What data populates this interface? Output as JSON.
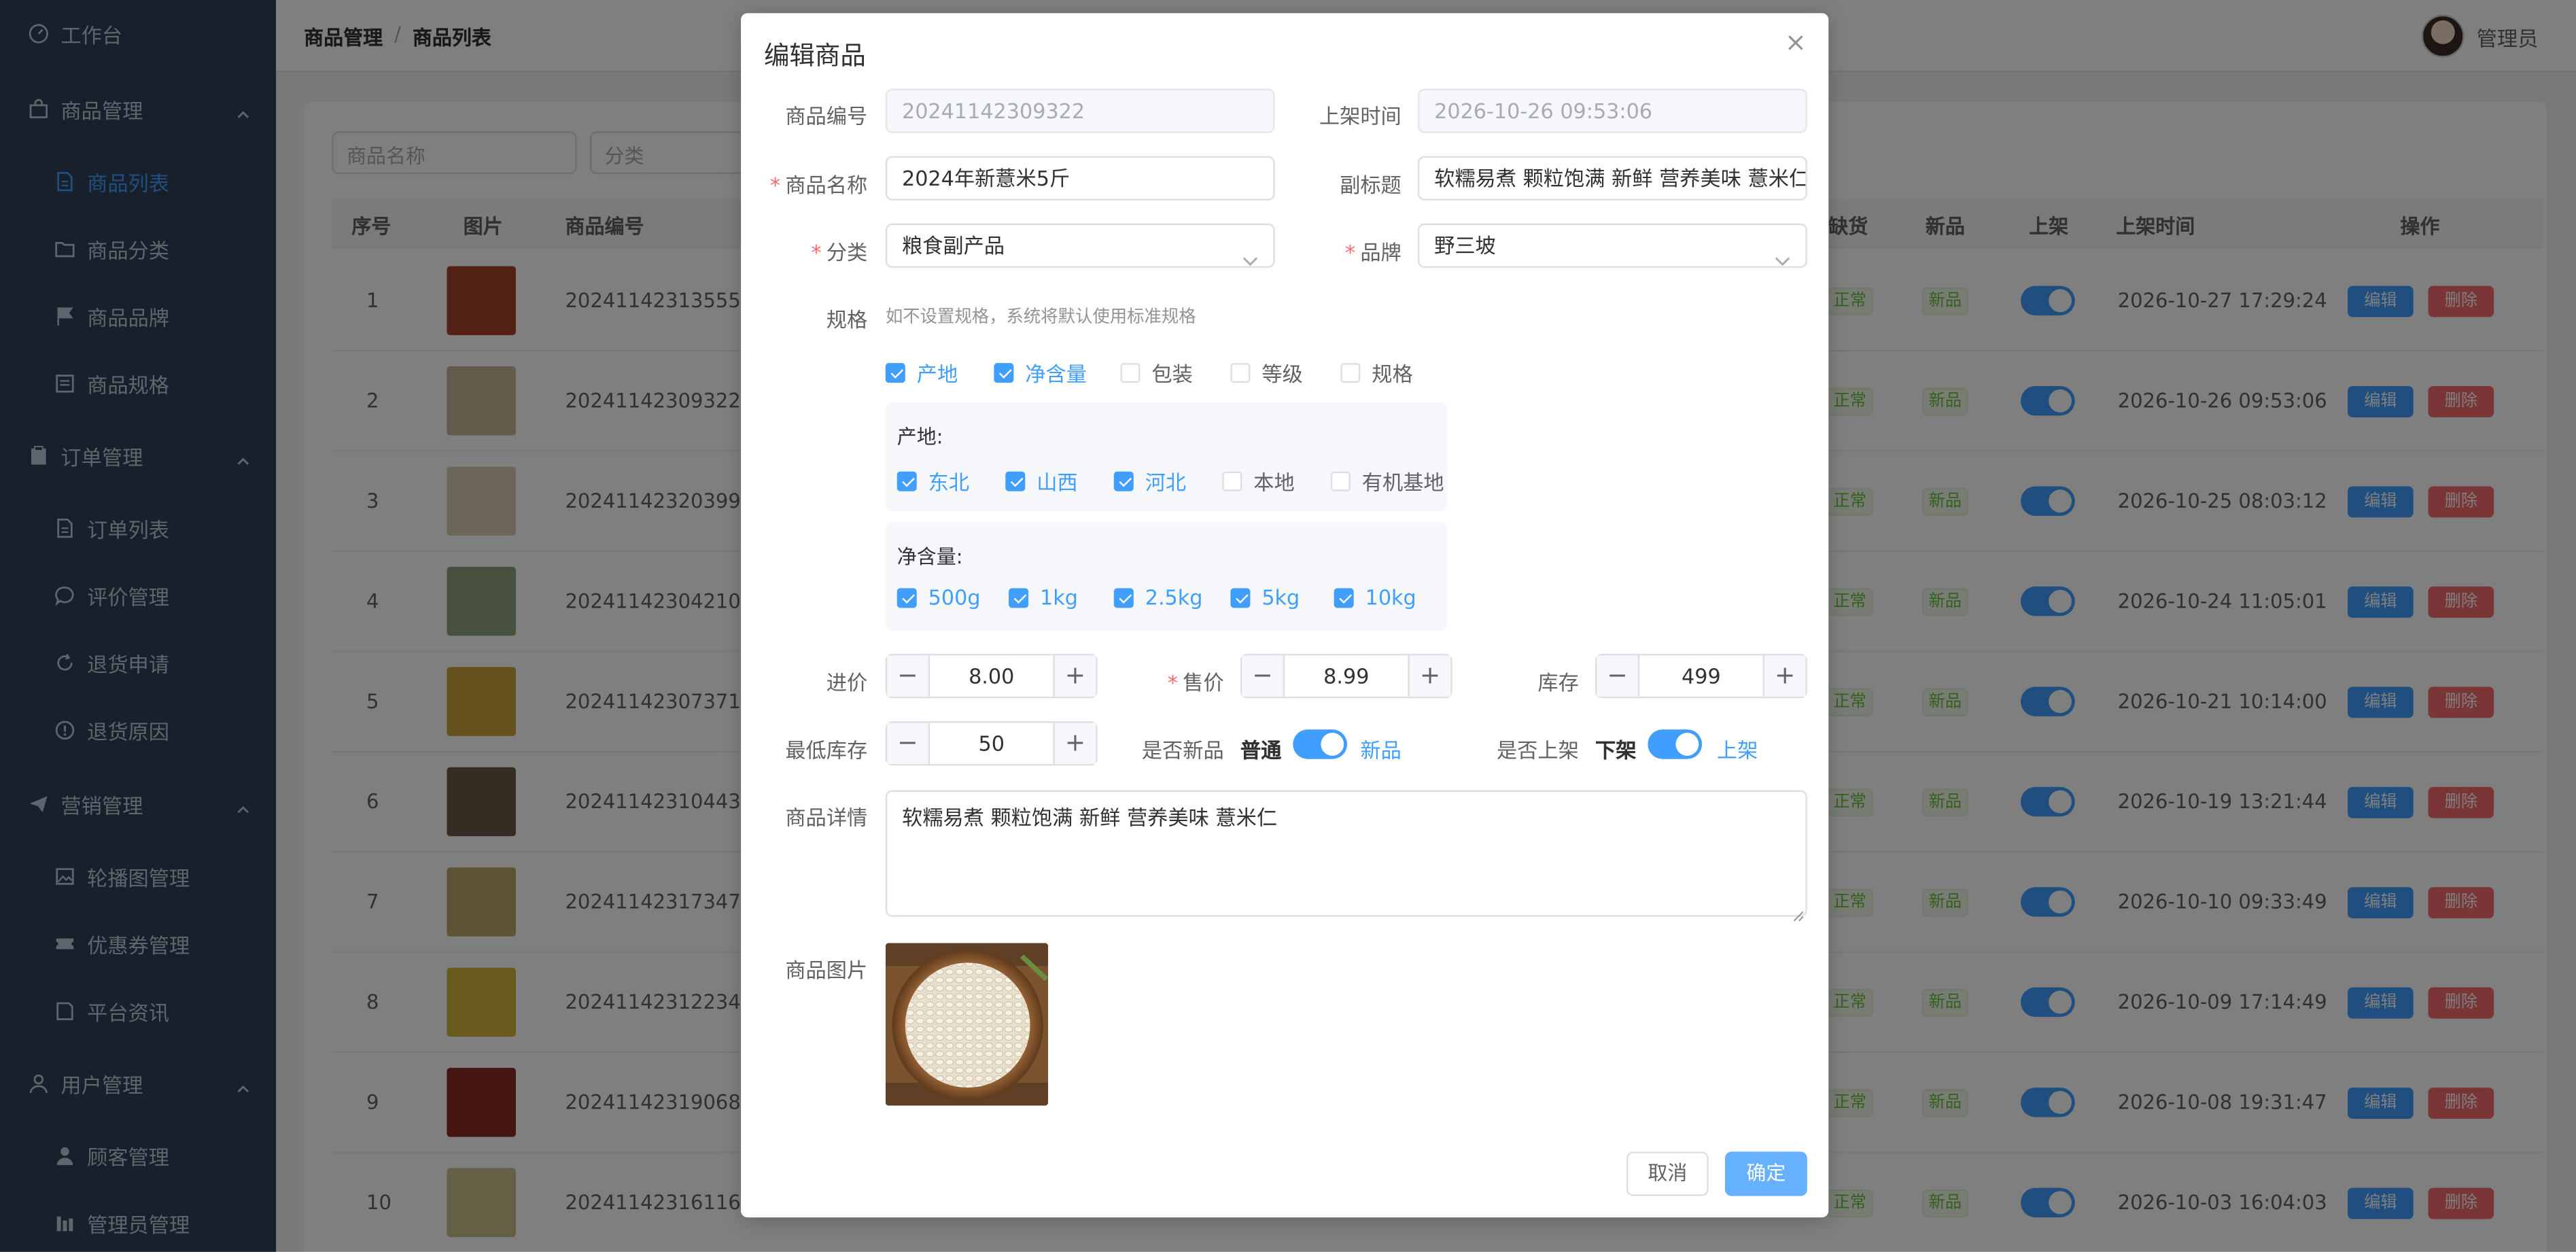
{
  "sidebar": {
    "items": [
      {
        "label": "工作台",
        "type": "top"
      },
      {
        "label": "商品管理",
        "type": "group"
      },
      {
        "label": "商品列表",
        "type": "sub",
        "active": true
      },
      {
        "label": "商品分类",
        "type": "sub"
      },
      {
        "label": "商品品牌",
        "type": "sub"
      },
      {
        "label": "商品规格",
        "type": "sub"
      },
      {
        "label": "订单管理",
        "type": "group"
      },
      {
        "label": "订单列表",
        "type": "sub"
      },
      {
        "label": "评价管理",
        "type": "sub"
      },
      {
        "label": "退货申请",
        "type": "sub"
      },
      {
        "label": "退货原因",
        "type": "sub"
      },
      {
        "label": "营销管理",
        "type": "group"
      },
      {
        "label": "轮播图管理",
        "type": "sub"
      },
      {
        "label": "优惠券管理",
        "type": "sub"
      },
      {
        "label": "平台资讯",
        "type": "sub"
      },
      {
        "label": "用户管理",
        "type": "group"
      },
      {
        "label": "顾客管理",
        "type": "sub"
      },
      {
        "label": "管理员管理",
        "type": "sub"
      }
    ]
  },
  "header": {
    "breadcrumb": [
      "商品管理",
      "商品列表"
    ],
    "separator": "/",
    "user": "管理员"
  },
  "filters": {
    "name_placeholder": "商品名称",
    "category_placeholder": "分类"
  },
  "table": {
    "columns": [
      "序号",
      "图片",
      "商品编号",
      "缺货",
      "新品",
      "上架",
      "上架时间",
      "操作"
    ],
    "stock_tag": "正常",
    "new_tag": "新品",
    "edit_label": "编辑",
    "delete_label": "删除",
    "rows": [
      {
        "index": "1",
        "code": "20241142313555",
        "time": "2026-10-27 17:29:24"
      },
      {
        "index": "2",
        "code": "20241142309322",
        "time": "2026-10-26 09:53:06"
      },
      {
        "index": "3",
        "code": "20241142320399",
        "time": "2026-10-25 08:03:12"
      },
      {
        "index": "4",
        "code": "20241142304210",
        "time": "2026-10-24 11:05:01"
      },
      {
        "index": "5",
        "code": "20241142307371",
        "time": "2026-10-21 10:14:00"
      },
      {
        "index": "6",
        "code": "20241142310443",
        "time": "2026-10-19 13:21:44"
      },
      {
        "index": "7",
        "code": "20241142317347",
        "time": "2026-10-10 09:33:49"
      },
      {
        "index": "8",
        "code": "20241142312234",
        "time": "2026-10-09 17:14:49"
      },
      {
        "index": "9",
        "code": "20241142319068",
        "time": "2026-10-08 19:31:47"
      },
      {
        "index": "10",
        "code": "20241142316116",
        "time": "2026-10-03 16:04:03"
      }
    ]
  },
  "dialog": {
    "title": "编辑商品",
    "code_label": "商品编号",
    "code_value": "20241142309322",
    "listed_time_label": "上架时间",
    "listed_time_value": "2026-10-26 09:53:06",
    "name_label": "商品名称",
    "name_value": "2024年新薏米5斤",
    "subtitle_label": "副标题",
    "subtitle_value": "软糯易煮 颗粒饱满 新鲜 营养美味 薏米仁",
    "category_label": "分类",
    "category_value": "粮食副产品",
    "brand_label": "品牌",
    "brand_value": "野三坡",
    "spec_label": "规格",
    "spec_hint": "如不设置规格，系统将默认使用标准规格",
    "spec_types": [
      {
        "label": "产地",
        "checked": true
      },
      {
        "label": "净含量",
        "checked": true
      },
      {
        "label": "包装",
        "checked": false
      },
      {
        "label": "等级",
        "checked": false
      },
      {
        "label": "规格",
        "checked": false
      }
    ],
    "origin_title": "产地:",
    "origin_options": [
      {
        "label": "东北",
        "checked": true
      },
      {
        "label": "山西",
        "checked": true
      },
      {
        "label": "河北",
        "checked": true
      },
      {
        "label": "本地",
        "checked": false
      },
      {
        "label": "有机基地",
        "checked": false
      }
    ],
    "weight_title": "净含量:",
    "weight_options": [
      {
        "label": "500g",
        "checked": true
      },
      {
        "label": "1kg",
        "checked": true
      },
      {
        "label": "2.5kg",
        "checked": true
      },
      {
        "label": "5kg",
        "checked": true
      },
      {
        "label": "10kg",
        "checked": true
      }
    ],
    "cost_label": "进价",
    "cost_value": "8.00",
    "price_label": "售价",
    "price_value": "8.99",
    "stock_label": "库存",
    "stock_value": "499",
    "min_stock_label": "最低库存",
    "min_stock_value": "50",
    "is_new_label": "是否新品",
    "is_new_off": "普通",
    "is_new_on": "新品",
    "is_new": true,
    "is_listed_label": "是否上架",
    "is_listed_off": "下架",
    "is_listed_on": "上架",
    "is_listed": true,
    "detail_label": "商品详情",
    "detail_value": "软糯易煮 颗粒饱满 新鲜 营养美味 薏米仁",
    "image_label": "商品图片",
    "cancel_label": "取消",
    "confirm_label": "确定"
  },
  "colors": {
    "primary": "#409eff",
    "danger": "#f56c6c",
    "sidebar_bg": "#304156",
    "edit_button": "#409eff",
    "delete_button": "#f56c6c"
  }
}
